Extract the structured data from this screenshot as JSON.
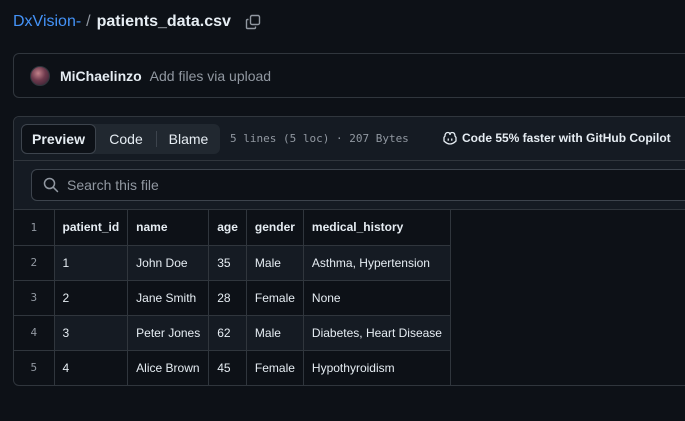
{
  "breadcrumb": {
    "repo": "DxVision-",
    "separator": "/",
    "file": "patients_data.csv"
  },
  "commit": {
    "author": "MiChaelinzo",
    "message": "Add files via upload"
  },
  "file_header": {
    "tabs": [
      "Preview",
      "Code",
      "Blame"
    ],
    "active_tab": "Preview",
    "meta": "5 lines (5 loc) · 207 Bytes",
    "copilot_text": "Code 55% faster with GitHub Copilot"
  },
  "search": {
    "placeholder": "Search this file",
    "value": ""
  },
  "table": {
    "line_numbers": [
      "1",
      "2",
      "3",
      "4",
      "5"
    ],
    "headers": [
      "patient_id",
      "name",
      "age",
      "gender",
      "medical_history"
    ],
    "rows": [
      [
        "1",
        "John Doe",
        "35",
        "Male",
        "Asthma, Hypertension"
      ],
      [
        "2",
        "Jane Smith",
        "28",
        "Female",
        "None"
      ],
      [
        "3",
        "Peter Jones",
        "62",
        "Male",
        "Diabetes, Heart Disease"
      ],
      [
        "4",
        "Alice Brown",
        "45",
        "Female",
        "Hypothyroidism"
      ]
    ]
  },
  "colors": {
    "background": "#0d1117",
    "link": "#4493f8",
    "border": "#30363d",
    "muted": "#9198a1"
  },
  "icons": [
    "copy-icon",
    "search-icon",
    "copilot-icon"
  ]
}
